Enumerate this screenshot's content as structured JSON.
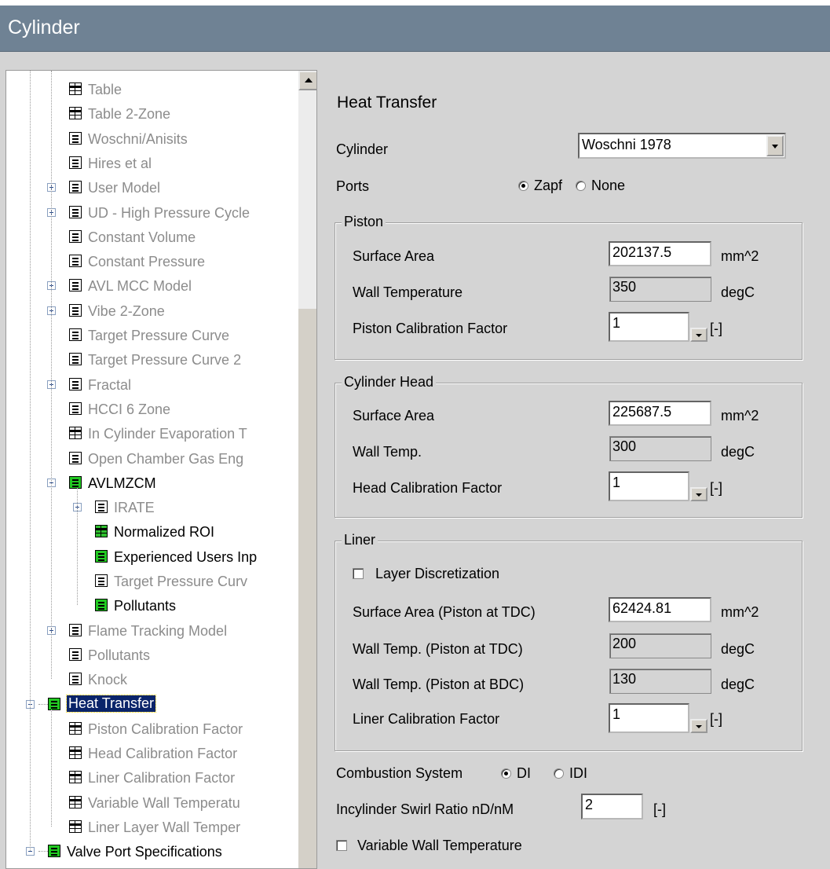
{
  "window": {
    "title": "Cylinder"
  },
  "tree": {
    "items": [
      {
        "label": "Table",
        "icon": "table-icon",
        "style": "gray"
      },
      {
        "label": "Table 2-Zone",
        "icon": "table-icon",
        "style": "gray"
      },
      {
        "label": "Woschni/Anisits",
        "icon": "form-icon",
        "style": "gray"
      },
      {
        "label": "Hires et al",
        "icon": "form-icon",
        "style": "gray"
      },
      {
        "label": "User Model",
        "icon": "form-icon",
        "style": "gray",
        "expander": "plus"
      },
      {
        "label": "UD - High Pressure Cycle",
        "icon": "form-icon",
        "style": "gray",
        "expander": "plus"
      },
      {
        "label": "Constant Volume",
        "icon": "form-icon",
        "style": "gray"
      },
      {
        "label": "Constant Pressure",
        "icon": "form-icon",
        "style": "gray"
      },
      {
        "label": "AVL MCC Model",
        "icon": "form-icon",
        "style": "gray",
        "expander": "plus"
      },
      {
        "label": "Vibe 2-Zone",
        "icon": "form-icon",
        "style": "gray",
        "expander": "plus"
      },
      {
        "label": "Target Pressure Curve",
        "icon": "form-icon",
        "style": "gray"
      },
      {
        "label": "Target Pressure Curve 2",
        "icon": "form-icon",
        "style": "gray"
      },
      {
        "label": "Fractal",
        "icon": "form-icon",
        "style": "gray",
        "expander": "plus"
      },
      {
        "label": "HCCI 6 Zone",
        "icon": "form-icon",
        "style": "gray"
      },
      {
        "label": "In Cylinder Evaporation T",
        "icon": "table-icon",
        "style": "gray"
      },
      {
        "label": "Open Chamber Gas Eng",
        "icon": "form-icon",
        "style": "gray"
      },
      {
        "label": "AVLMZCM",
        "icon": "form-icon-green",
        "style": "black",
        "expander": "minus"
      },
      {
        "label": "IRATE",
        "icon": "form-icon",
        "style": "gray",
        "expander": "plus"
      },
      {
        "label": "Normalized ROI",
        "icon": "table-icon-green",
        "style": "black"
      },
      {
        "label": "Experienced Users Inp",
        "icon": "form-icon-green",
        "style": "black"
      },
      {
        "label": "Target Pressure Curv",
        "icon": "form-icon",
        "style": "gray"
      },
      {
        "label": "Pollutants",
        "icon": "form-icon-green",
        "style": "black"
      },
      {
        "label": "Flame Tracking Model",
        "icon": "form-icon",
        "style": "gray",
        "expander": "plus"
      },
      {
        "label": "Pollutants",
        "icon": "form-icon",
        "style": "gray"
      },
      {
        "label": "Knock",
        "icon": "form-icon",
        "style": "gray"
      },
      {
        "label": "Heat Transfer",
        "icon": "form-icon-green",
        "style": "selected",
        "expander": "minus"
      },
      {
        "label": "Piston Calibration Factor",
        "icon": "table-icon",
        "style": "gray"
      },
      {
        "label": "Head Calibration Factor",
        "icon": "table-icon",
        "style": "gray"
      },
      {
        "label": "Liner Calibration Factor",
        "icon": "table-icon",
        "style": "gray"
      },
      {
        "label": "Variable Wall Temperatu",
        "icon": "table-icon",
        "style": "gray"
      },
      {
        "label": "Liner Layer Wall Temper",
        "icon": "table-icon",
        "style": "gray"
      },
      {
        "label": "Valve Port Specifications",
        "icon": "form-icon-green",
        "style": "black",
        "expander": "minus"
      }
    ]
  },
  "form": {
    "heading": "Heat Transfer",
    "cylinder_label": "Cylinder",
    "cylinder_value": "Woschni 1978",
    "ports_label": "Ports",
    "ports_options": [
      "Zapf",
      "None"
    ],
    "ports_selected": "Zapf",
    "piston": {
      "title": "Piston",
      "surface_area_label": "Surface Area",
      "surface_area_value": "202137.5",
      "surface_area_unit": "mm^2",
      "wall_temp_label": "Wall Temperature",
      "wall_temp_value": "350",
      "wall_temp_unit": "degC",
      "calib_label": "Piston Calibration Factor",
      "calib_value": "1",
      "calib_unit": "[-]"
    },
    "head": {
      "title": "Cylinder Head",
      "surface_area_label": "Surface Area",
      "surface_area_value": "225687.5",
      "surface_area_unit": "mm^2",
      "wall_temp_label": "Wall Temp.",
      "wall_temp_value": "300",
      "wall_temp_unit": "degC",
      "calib_label": "Head Calibration Factor",
      "calib_value": "1",
      "calib_unit": "[-]"
    },
    "liner": {
      "title": "Liner",
      "layer_label": "Layer Discretization",
      "layer_checked": false,
      "surface_area_label": "Surface Area (Piston at TDC)",
      "surface_area_value": "62424.81",
      "surface_area_unit": "mm^2",
      "wall_tdc_label": "Wall Temp. (Piston at TDC)",
      "wall_tdc_value": "200",
      "wall_tdc_unit": "degC",
      "wall_bdc_label": "Wall Temp. (Piston at BDC)",
      "wall_bdc_value": "130",
      "wall_bdc_unit": "degC",
      "calib_label": "Liner Calibration Factor",
      "calib_value": "1",
      "calib_unit": "[-]"
    },
    "combustion_label": "Combustion System",
    "combustion_options": [
      "DI",
      "IDI"
    ],
    "combustion_selected": "DI",
    "swirl_label": "Incylinder Swirl Ratio nD/nM",
    "swirl_value": "2",
    "swirl_unit": "[-]",
    "variable_wall_label": "Variable Wall Temperature",
    "variable_wall_checked": false
  }
}
